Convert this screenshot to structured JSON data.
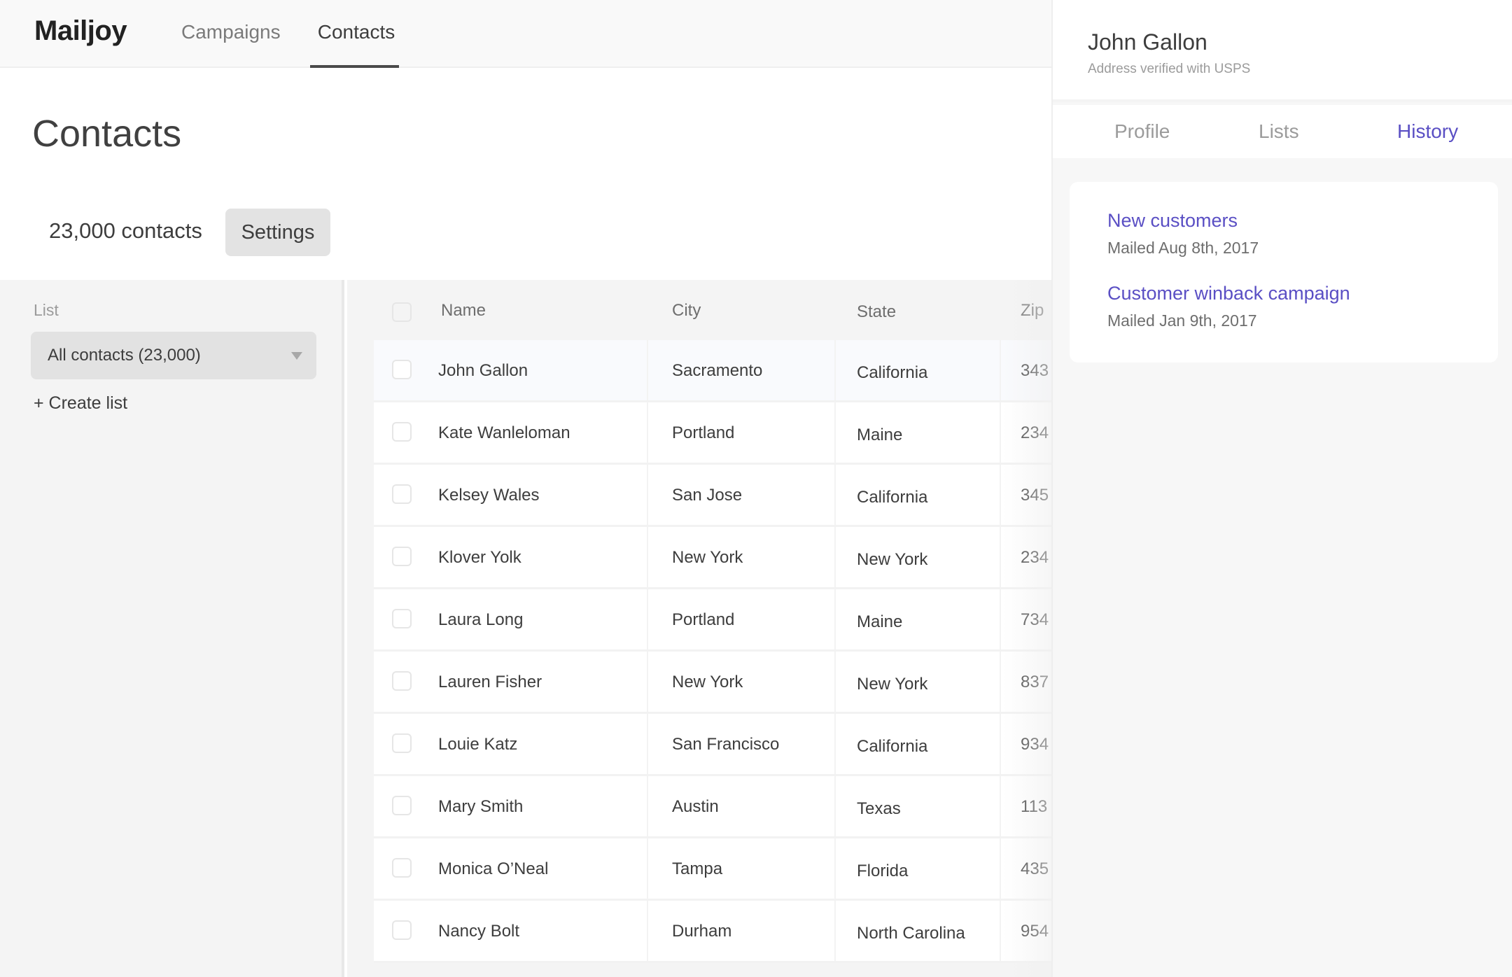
{
  "app": {
    "logo": "Mailjoy",
    "nav": [
      {
        "label": "Campaigns",
        "active": false
      },
      {
        "label": "Contacts",
        "active": true
      }
    ]
  },
  "page": {
    "title": "Contacts",
    "count_label": "23,000 contacts",
    "settings_label": "Settings"
  },
  "sidebar": {
    "list_label": "List",
    "selected_list": "All contacts (23,000)",
    "create_list_label": "+ Create list"
  },
  "table": {
    "columns": [
      "Name",
      "City",
      "State",
      "Zip"
    ],
    "rows": [
      {
        "name": "John Gallon",
        "city": "Sacramento",
        "state": "California",
        "zip": "343",
        "selected": true
      },
      {
        "name": "Kate Wanleloman",
        "city": "Portland",
        "state": "Maine",
        "zip": "234"
      },
      {
        "name": "Kelsey Wales",
        "city": "San Jose",
        "state": "California",
        "zip": "345"
      },
      {
        "name": "Klover Yolk",
        "city": "New York",
        "state": "New York",
        "zip": "234"
      },
      {
        "name": "Laura Long",
        "city": "Portland",
        "state": "Maine",
        "zip": "734"
      },
      {
        "name": "Lauren Fisher",
        "city": "New York",
        "state": "New York",
        "zip": "837"
      },
      {
        "name": "Louie Katz",
        "city": "San Francisco",
        "state": "California",
        "zip": "934"
      },
      {
        "name": "Mary Smith",
        "city": "Austin",
        "state": "Texas",
        "zip": "113"
      },
      {
        "name": "Monica O’Neal",
        "city": "Tampa",
        "state": "Florida",
        "zip": "435"
      },
      {
        "name": "Nancy Bolt",
        "city": "Durham",
        "state": "North Carolina",
        "zip": "954"
      }
    ]
  },
  "panel": {
    "contact_name": "John Gallon",
    "subtitle": "Address verified with USPS",
    "tabs": [
      {
        "label": "Profile",
        "active": false
      },
      {
        "label": "Lists",
        "active": false
      },
      {
        "label": "History",
        "active": true
      }
    ],
    "history": [
      {
        "title": "New customers",
        "date": "Mailed Aug 8th, 2017"
      },
      {
        "title": "Customer winback campaign",
        "date": "Mailed Jan 9th, 2017"
      }
    ]
  },
  "colors": {
    "accent": "#5a4fc4",
    "text": "#3d3d3d",
    "muted": "#9b9b9b"
  }
}
